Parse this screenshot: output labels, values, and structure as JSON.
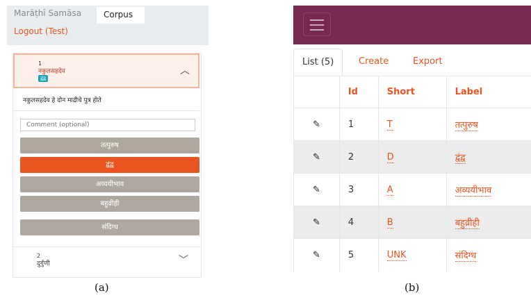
{
  "panel_a": {
    "nav": {
      "brand": "Marāṭhī Samāsa",
      "tab": "Corpus",
      "logout": "Logout (Test)"
    },
    "item1": {
      "number": "1",
      "title": "नकुलसहदेव",
      "badge": "द्वंद्व",
      "description": "नकुलसहदेव हे दोन माद्रीचे पुत्र होते"
    },
    "comment_placeholder": "Comment (optional)",
    "options": [
      {
        "label": "तत्पुरुष",
        "color": "#aea79f"
      },
      {
        "label": "द्वंद्व",
        "color": "#e95420"
      },
      {
        "label": "अव्ययीभाव",
        "color": "#aea79f"
      },
      {
        "label": "बहुव्रीही",
        "color": "#aea79f"
      },
      {
        "label": "संदिग्ध",
        "color": "#aea79f"
      }
    ],
    "item2": {
      "number": "2",
      "title": "दुर्गुणी"
    },
    "caption": "(a)"
  },
  "panel_b": {
    "tabs": [
      "List (5)",
      "Create",
      "Export"
    ],
    "columns": [
      "Id",
      "Short",
      "Label"
    ],
    "rows": [
      {
        "id": "1",
        "short": "T",
        "label": "तत्पुरुष"
      },
      {
        "id": "2",
        "short": "D",
        "label": "द्वंद्व"
      },
      {
        "id": "3",
        "short": "A",
        "label": "अव्ययीभाव"
      },
      {
        "id": "4",
        "short": "B",
        "label": "बहुव्रीही"
      },
      {
        "id": "5",
        "short": "UNK",
        "label": "संदिग्ध"
      }
    ],
    "caption": "(b)"
  },
  "colors": {
    "primary": "#e95420",
    "navbar": "#772953",
    "secondary": "#aea79f",
    "info": "#17a2b8"
  },
  "icons": {
    "edit": "pencil-icon",
    "collapse": "chevron-up-icon",
    "expand": "chevron-down-icon",
    "menu": "hamburger-icon"
  }
}
